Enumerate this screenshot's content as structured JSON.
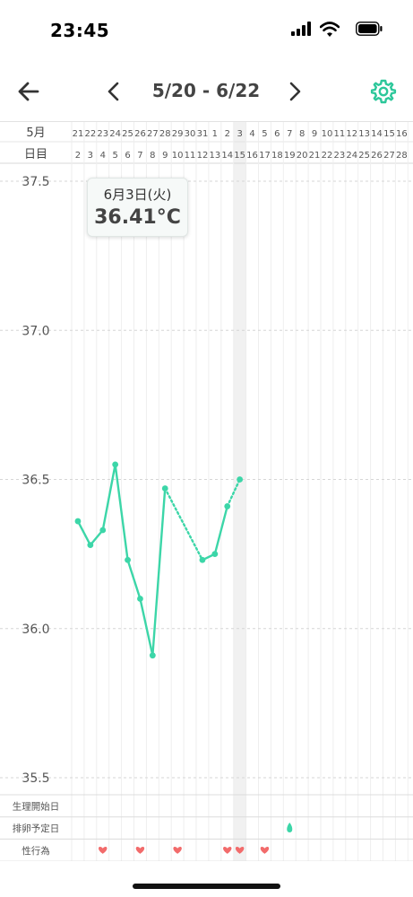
{
  "status_bar": {
    "time": "23:45"
  },
  "header": {
    "date_range": "5/20 - 6/22"
  },
  "chart_data": {
    "type": "line",
    "month_label": "5月",
    "day_label": "日目",
    "dates": [
      "21",
      "22",
      "23",
      "24",
      "25",
      "26",
      "27",
      "28",
      "29",
      "30",
      "31",
      "1",
      "2",
      "3",
      "4",
      "5",
      "6",
      "7",
      "8",
      "9",
      "10",
      "11",
      "12",
      "13",
      "14",
      "15",
      "16"
    ],
    "cycle_days": [
      "2",
      "3",
      "4",
      "5",
      "6",
      "7",
      "8",
      "9",
      "10",
      "11",
      "12",
      "13",
      "14",
      "15",
      "16",
      "17",
      "18",
      "19",
      "20",
      "21",
      "22",
      "23",
      "24",
      "25",
      "26",
      "27",
      "28"
    ],
    "series": [
      {
        "values": [
          36.36,
          36.28,
          36.33,
          36.55,
          36.23,
          36.1,
          35.91,
          36.47,
          null,
          null,
          36.23,
          36.25,
          36.41,
          36.5
        ]
      }
    ],
    "estimated_segments": [
      [
        7,
        10
      ],
      [
        12,
        13
      ]
    ],
    "ylim": [
      35.45,
      37.52
    ],
    "yticks": [
      "37.5",
      "37.0",
      "36.5",
      "36.0",
      "35.5"
    ],
    "highlight_index": 13,
    "tooltip": {
      "date": "6月3日(火)",
      "value": "36.41°C"
    },
    "marker_rows": [
      {
        "label": "生理開始日",
        "indices": [],
        "icon": ""
      },
      {
        "label": "排卵予定日",
        "indices": [
          17
        ],
        "icon": "drop-icon"
      },
      {
        "label": "性行為",
        "indices": [
          2,
          5,
          8,
          12,
          13,
          15
        ],
        "icon": "heart-icon"
      }
    ],
    "colors": {
      "line": "#3cd6a8",
      "heart": "#f26b6b",
      "highlight": "#f1f1f1",
      "grid": "#e4e4e4"
    }
  }
}
